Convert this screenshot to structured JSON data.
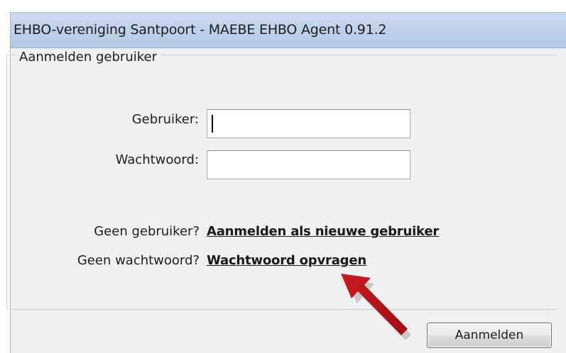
{
  "window": {
    "title": "EHBO-vereniging Santpoort - MAEBE EHBO Agent 0.91.2"
  },
  "login_group": {
    "legend": "Aanmelden gebruiker",
    "user_label": "Gebruiker:",
    "user_value": "",
    "password_label": "Wachtwoord:",
    "password_value": ""
  },
  "help": {
    "no_user_text": "Geen gebruiker?",
    "register_link": "Aanmelden als nieuwe gebruiker",
    "no_password_text": "Geen wachtwoord?",
    "password_link": "Wachtwoord opvragen"
  },
  "actions": {
    "login_button": "Aanmelden"
  },
  "colors": {
    "titlebar": "#bfd2ea",
    "window_background": "#f0f0f0",
    "annotation_arrow": "#c0141b"
  },
  "icons": {
    "annotation": "red-arrow-icon"
  }
}
